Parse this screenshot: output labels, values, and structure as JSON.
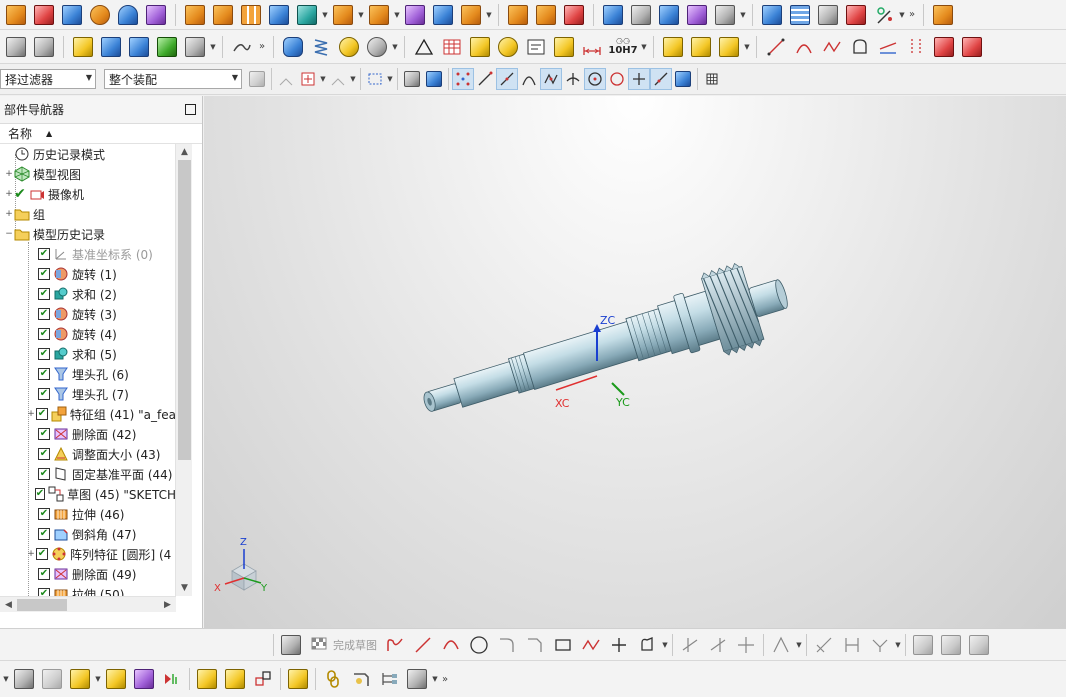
{
  "toolbar": {
    "selection_filter": "择过滤器",
    "assembly_scope": "整个装配",
    "fit_label": "10H7",
    "finish_sketch": "完成草图"
  },
  "navigator": {
    "title": "部件导航器",
    "column_name": "名称",
    "items": [
      {
        "label": "历史记录模式",
        "indent": 0
      },
      {
        "label": "模型视图",
        "indent": 0
      },
      {
        "label": "摄像机",
        "indent": 0
      },
      {
        "label": "组",
        "indent": 0
      },
      {
        "label": "模型历史记录",
        "indent": 0
      },
      {
        "label": "基准坐标系 (0)",
        "indent": 1,
        "dim": true
      },
      {
        "label": "旋转 (1)",
        "indent": 1
      },
      {
        "label": "求和 (2)",
        "indent": 1
      },
      {
        "label": "旋转 (3)",
        "indent": 1
      },
      {
        "label": "旋转 (4)",
        "indent": 1
      },
      {
        "label": "求和 (5)",
        "indent": 1
      },
      {
        "label": "埋头孔 (6)",
        "indent": 1
      },
      {
        "label": "埋头孔 (7)",
        "indent": 1
      },
      {
        "label": "特征组 (41) \"a_fea",
        "indent": 1
      },
      {
        "label": "删除面 (42)",
        "indent": 1
      },
      {
        "label": "调整面大小 (43)",
        "indent": 1
      },
      {
        "label": "固定基准平面 (44)",
        "indent": 1
      },
      {
        "label": "草图 (45) \"SKETCH",
        "indent": 1
      },
      {
        "label": "拉伸 (46)",
        "indent": 1
      },
      {
        "label": "倒斜角 (47)",
        "indent": 1
      },
      {
        "label": "阵列特征 [圆形] (4",
        "indent": 1
      },
      {
        "label": "删除面 (49)",
        "indent": 1
      },
      {
        "label": "拉伸 (50)",
        "indent": 1
      }
    ]
  },
  "viewport": {
    "axis_zc": "ZC",
    "axis_xc": "XC",
    "axis_yc": "YC",
    "triad_z": "Z",
    "triad_x": "X",
    "triad_y": "Y"
  },
  "colors": {
    "accent": "#3b82d6",
    "check": "#1c8a1c",
    "shaft": "#b8d4df"
  }
}
